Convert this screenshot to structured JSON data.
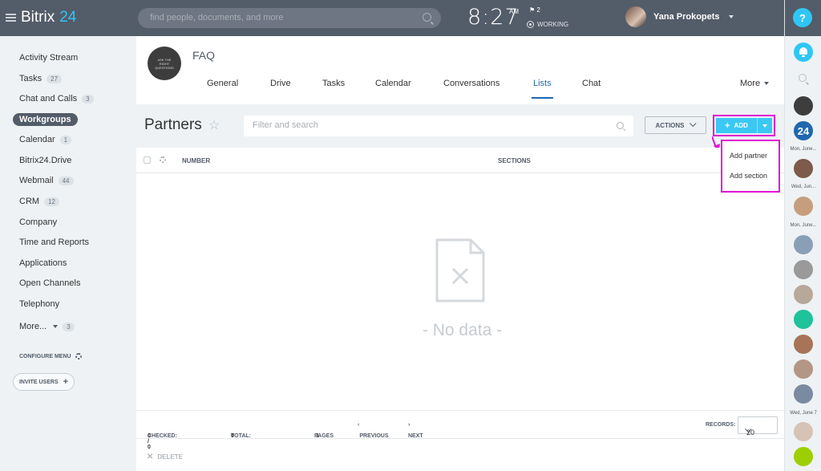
{
  "topbar": {
    "logo_main": "Bitrix",
    "logo_accent": "24",
    "search_placeholder": "find people, documents, and more",
    "clock_time": "8:27",
    "clock_ampm": "AM",
    "flag_count": "2",
    "status": "WORKING",
    "user_name": "Yana Prokopets"
  },
  "sidebar": {
    "items": [
      {
        "label": "Activity Stream",
        "badge": ""
      },
      {
        "label": "Tasks",
        "badge": "27"
      },
      {
        "label": "Chat and Calls",
        "badge": "3"
      },
      {
        "label": "Workgroups",
        "badge": ""
      },
      {
        "label": "Calendar",
        "badge": "1"
      },
      {
        "label": "Bitrix24.Drive",
        "badge": ""
      },
      {
        "label": "Webmail",
        "badge": "44"
      },
      {
        "label": "CRM",
        "badge": "12"
      },
      {
        "label": "Company",
        "badge": ""
      },
      {
        "label": "Time and Reports",
        "badge": ""
      },
      {
        "label": "Applications",
        "badge": ""
      },
      {
        "label": "Open Channels",
        "badge": ""
      },
      {
        "label": "Telephony",
        "badge": ""
      },
      {
        "label": "More...",
        "badge": "3"
      }
    ],
    "configure_menu": "CONFIGURE MENU",
    "invite_users": "INVITE USERS"
  },
  "group": {
    "title": "FAQ",
    "avatar_text": "ASK THE RIGHT QUESTIONS",
    "tabs": [
      "General",
      "Drive",
      "Tasks",
      "Calendar",
      "Conversations",
      "Lists",
      "Chat"
    ],
    "active_tab": "Lists",
    "more": "More"
  },
  "list": {
    "title": "Partners",
    "filter_placeholder": "Filter and search",
    "actions_label": "ACTIONS",
    "add_label": "ADD",
    "dropdown": [
      "Add partner",
      "Add section"
    ],
    "columns": [
      "NUMBER",
      "SECTIONS"
    ],
    "empty_text": "- No data -"
  },
  "footer": {
    "checked_label": "CHECKED:",
    "checked_value": "0 / 0",
    "total_label": "TOTAL:",
    "total_value": "0",
    "pages_label": "PAGES",
    "pages_value": "1",
    "previous": "PREVIOUS",
    "next": "NEXT",
    "records_label": "RECORDS:",
    "records_value": "20",
    "delete": "DELETE"
  },
  "rightbar": {
    "help": "?",
    "labels": [
      "Mon, June...",
      "Wed, Jun...",
      "Mon, June...",
      "Wed, June 7"
    ],
    "badge_24": "24"
  },
  "colors": {
    "topbar": "#535c69",
    "accent": "#2fc6f6",
    "active_tab": "#2067b0",
    "highlight": "#e012d3",
    "add_button": "#3bc8f5"
  }
}
